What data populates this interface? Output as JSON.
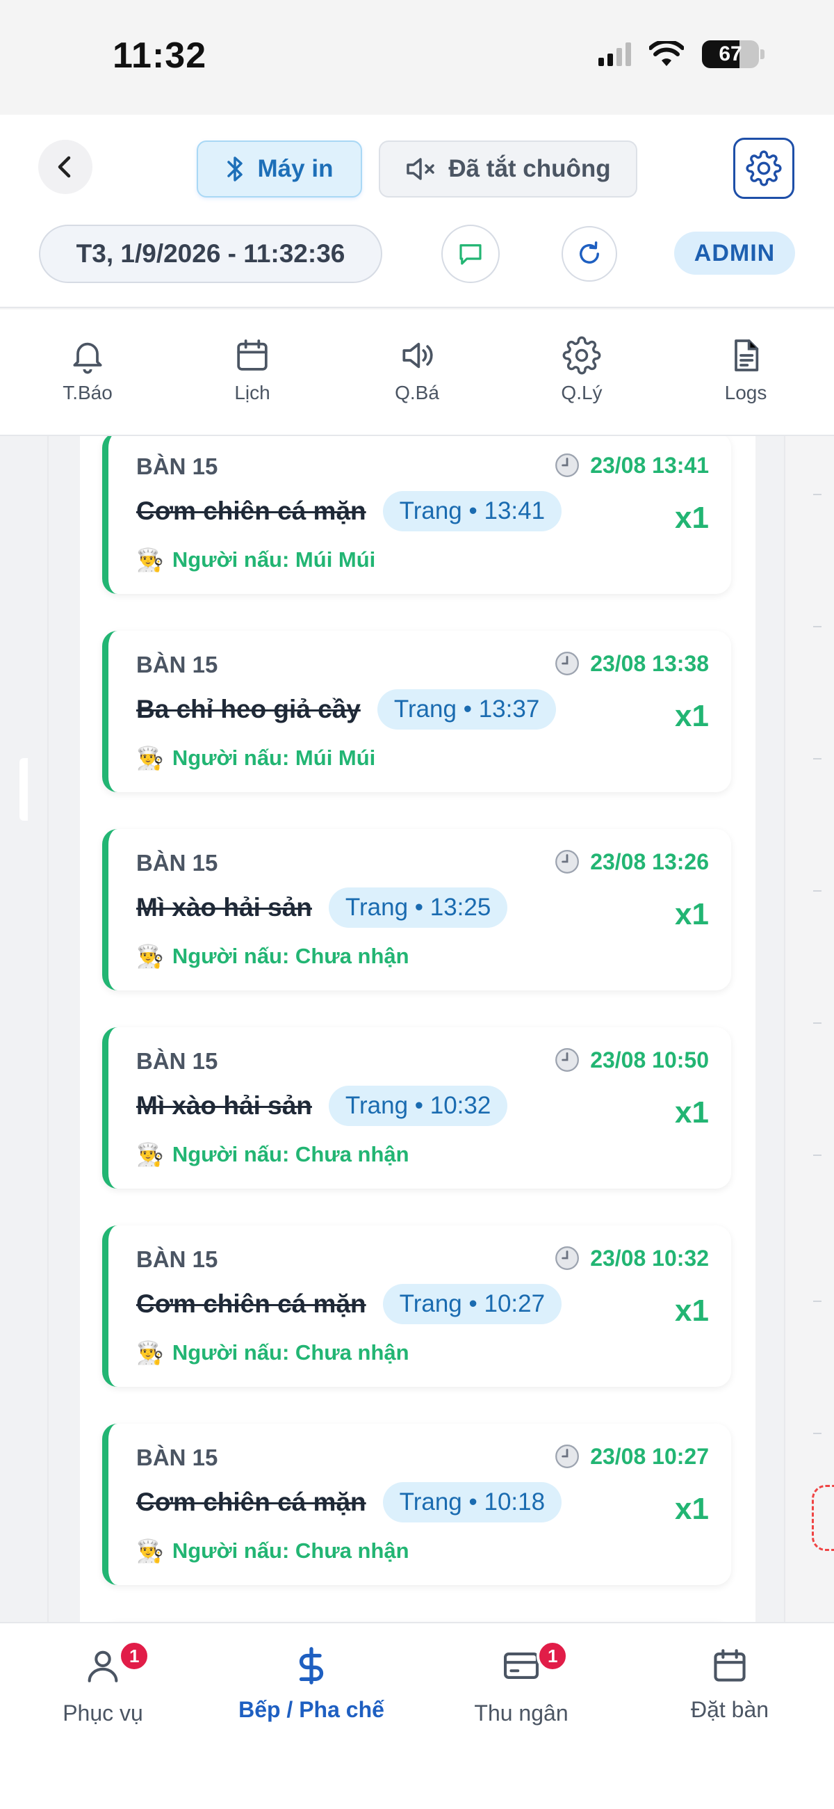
{
  "status_bar": {
    "time": "11:32",
    "battery": "67"
  },
  "header": {
    "printer_label": "Máy in",
    "bell_label": "Đã tắt chuông",
    "datetime": "T3, 1/9/2026 - 11:32:36",
    "role_badge": "ADMIN"
  },
  "top_nav": {
    "items": [
      {
        "label": "T.Báo",
        "icon": "bell-icon"
      },
      {
        "label": "Lịch",
        "icon": "calendar-icon"
      },
      {
        "label": "Q.Bá",
        "icon": "speaker-icon"
      },
      {
        "label": "Q.Lý",
        "icon": "gear-icon"
      },
      {
        "label": "Logs",
        "icon": "document-icon"
      }
    ]
  },
  "orders": [
    {
      "table": "BÀN 15",
      "time": "23/08 13:41",
      "dish": "Cơm chiên cá mặn",
      "tag": "Trang • 13:41",
      "cook": "Người nấu: Múi Múi",
      "qty": "x1"
    },
    {
      "table": "BÀN 15",
      "time": "23/08 13:38",
      "dish": "Ba chỉ heo giả cầy",
      "tag": "Trang • 13:37",
      "cook": "Người nấu: Múi Múi",
      "qty": "x1"
    },
    {
      "table": "BÀN 15",
      "time": "23/08 13:26",
      "dish": "Mì xào hải sản",
      "tag": "Trang • 13:25",
      "cook": "Người nấu: Chưa nhận",
      "qty": "x1"
    },
    {
      "table": "BÀN 15",
      "time": "23/08 10:50",
      "dish": "Mì xào hải sản",
      "tag": "Trang • 10:32",
      "cook": "Người nấu: Chưa nhận",
      "qty": "x1"
    },
    {
      "table": "BÀN 15",
      "time": "23/08 10:32",
      "dish": "Cơm chiên cá mặn",
      "tag": "Trang • 10:27",
      "cook": "Người nấu: Chưa nhận",
      "qty": "x1"
    },
    {
      "table": "BÀN 15",
      "time": "23/08 10:27",
      "dish": "Cơm chiên cá mặn",
      "tag": "Trang • 10:18",
      "cook": "Người nấu: Chưa nhận",
      "qty": "x1"
    }
  ],
  "bottom_nav": {
    "items": [
      {
        "label": "Phục vụ",
        "badge": "1"
      },
      {
        "label": "Bếp / Pha chế",
        "badge": ""
      },
      {
        "label": "Thu ngân",
        "badge": "1"
      },
      {
        "label": "Đặt bàn",
        "badge": ""
      }
    ],
    "active": "Bếp / Pha chế"
  },
  "colors": {
    "accent": "#1e5fc1",
    "success": "#22b573",
    "badge": "#e11d48",
    "tag_bg": "#dcf0fc"
  }
}
